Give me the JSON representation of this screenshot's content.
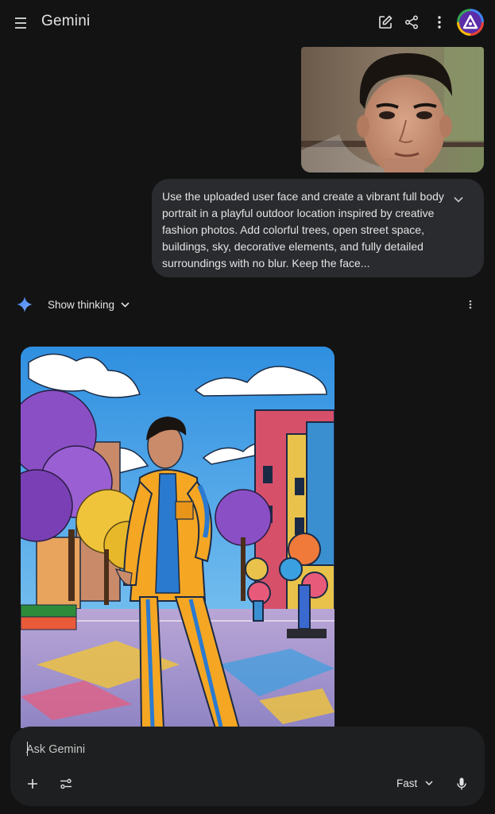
{
  "header": {
    "title": "Gemini",
    "icons": [
      "menu-icon",
      "edit-icon",
      "share-icon",
      "more-vert-icon",
      "avatar"
    ],
    "avatar_colors": [
      "#4285f4",
      "#ea4335",
      "#fbbc04",
      "#34a853"
    ]
  },
  "conversation": {
    "user_image": "uploaded-face-photo",
    "user_message": "Use the uploaded user face and create a vibrant full body portrait in a playful outdoor location inspired by creative fashion photos. Add colorful trees, open street space, buildings, sky, decorative elements, and fully detailed surroundings with no blur. Keep the face...",
    "response": {
      "show_thinking_label": "Show thinking",
      "generated_image": "generated-portrait-illustration"
    }
  },
  "input": {
    "placeholder": "Ask Gemini",
    "value": "",
    "mode_label": "Fast"
  },
  "colors": {
    "background": "#131314",
    "bubble": "#2a2b2e",
    "input_panel": "#1e1f20",
    "text": "#e3e3e3",
    "gemini_blue": "#4285f4"
  }
}
